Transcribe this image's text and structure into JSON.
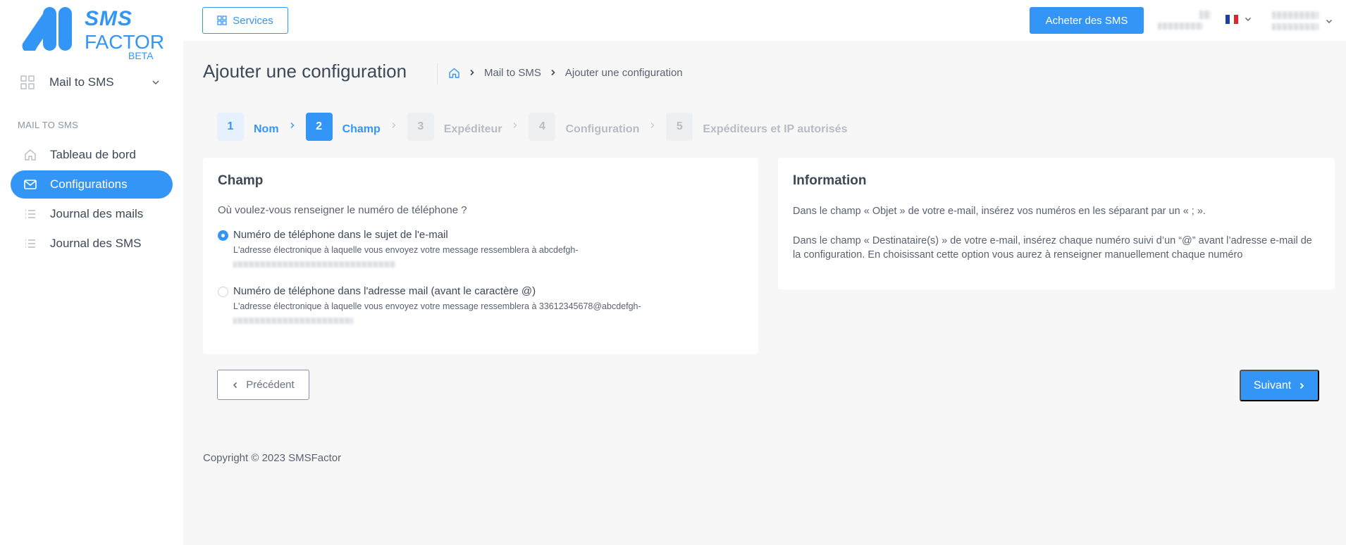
{
  "brand": {
    "name_top": "SMS",
    "name_bottom": "FACTOR",
    "badge": "BETA",
    "color": "#3395f5"
  },
  "sidebar": {
    "module_label": "Mail to SMS",
    "section_title": "MAIL TO SMS",
    "items": [
      {
        "label": "Tableau de bord",
        "icon": "home-icon",
        "active": false
      },
      {
        "label": "Configurations",
        "icon": "mail-icon",
        "active": true
      },
      {
        "label": "Journal des mails",
        "icon": "list-icon",
        "active": false
      },
      {
        "label": "Journal des SMS",
        "icon": "list-icon",
        "active": false
      }
    ]
  },
  "topbar": {
    "services_label": "Services",
    "buy_label": "Acheter des SMS"
  },
  "page": {
    "title": "Ajouter une configuration",
    "breadcrumb": [
      "Mail to SMS",
      "Ajouter une configuration"
    ]
  },
  "stepper": [
    {
      "num": "1",
      "label": "Nom",
      "state": "done"
    },
    {
      "num": "2",
      "label": "Champ",
      "state": "current"
    },
    {
      "num": "3",
      "label": "Expéditeur",
      "state": "todo"
    },
    {
      "num": "4",
      "label": "Configuration",
      "state": "todo"
    },
    {
      "num": "5",
      "label": "Expéditeurs et IP autorisés",
      "state": "todo"
    }
  ],
  "field_card": {
    "title": "Champ",
    "question": "Où voulez-vous renseigner le numéro de téléphone ?",
    "options": [
      {
        "label": "Numéro de téléphone dans le sujet de l'e-mail",
        "desc": "L'adresse électronique à laquelle vous envoyez votre message ressemblera à abcdefgh-",
        "checked": true
      },
      {
        "label": "Numéro de téléphone dans l'adresse mail (avant le caractère @)",
        "desc": "L'adresse électronique à laquelle vous envoyez votre message ressemblera à 33612345678@abcdefgh-",
        "checked": false
      }
    ]
  },
  "info_card": {
    "title": "Information",
    "paragraph_1": "Dans le champ « Objet » de votre e-mail, insérez vos numéros en les séparant par un « ; ».",
    "paragraph_2": "Dans le champ « Destinataire(s) » de votre e-mail, insérez chaque numéro suivi d’un “@”  avant l’adresse e-mail de la configuration. En choisissant cette option vous aurez à renseigner manuellement chaque numéro"
  },
  "actions": {
    "prev_label": "Précédent",
    "next_label": "Suivant"
  },
  "footer": {
    "copyright": "Copyright © 2023 SMSFactor"
  }
}
